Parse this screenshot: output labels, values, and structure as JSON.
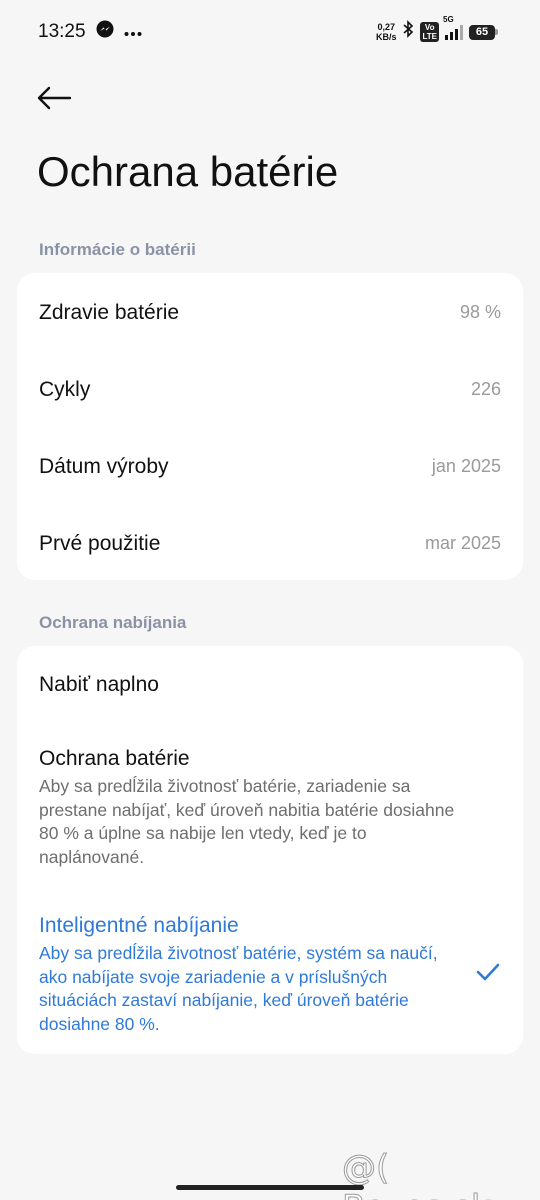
{
  "status_bar": {
    "time": "13:25",
    "net_speed_value": "0,27",
    "net_speed_unit": "KB/s",
    "volte_top": "Vo",
    "volte_bottom": "LTE",
    "network": "5G",
    "battery_level": "65"
  },
  "header": {
    "title": "Ochrana batérie"
  },
  "battery_info": {
    "section_title": "Informácie o batérii",
    "rows": [
      {
        "label": "Zdravie batérie",
        "value": "98 %"
      },
      {
        "label": "Cykly",
        "value": "226"
      },
      {
        "label": "Dátum výroby",
        "value": "jan 2025"
      },
      {
        "label": "Prvé použitie",
        "value": "mar 2025"
      }
    ]
  },
  "charging_protection": {
    "section_title": "Ochrana nabíjania",
    "options": [
      {
        "title": "Nabiť naplno",
        "description": ""
      },
      {
        "title": "Ochrana batérie",
        "description": "Aby sa predĺžila životnosť batérie, zariadenie sa prestane nabíjať, keď úroveň nabitia batérie dosiahne 80 % a úplne sa nabije len vtedy, keď je to naplánované."
      },
      {
        "title": "Inteligentné nabíjanie",
        "description": "Aby sa predĺžila životnosť batérie, systém sa naučí, ako nabíjate svoje zariadenie a v príslušných situáciách zastaví nabíjanie, keď úroveň batérie dosiahne 80 %."
      }
    ],
    "selected_index": 2
  },
  "watermark": "@( Bazos.sk",
  "colors": {
    "background": "#f6f6f6",
    "card": "#ffffff",
    "accent": "#2f7ad8",
    "section_header": "#8a93a6",
    "secondary_text": "#9a9a9a"
  },
  "icons": {
    "back": "arrow-left-icon",
    "messenger": "messenger-icon",
    "more": "more-dots-icon",
    "bluetooth": "bluetooth-icon",
    "signal": "signal-icon",
    "battery": "battery-icon",
    "check": "check-icon"
  }
}
